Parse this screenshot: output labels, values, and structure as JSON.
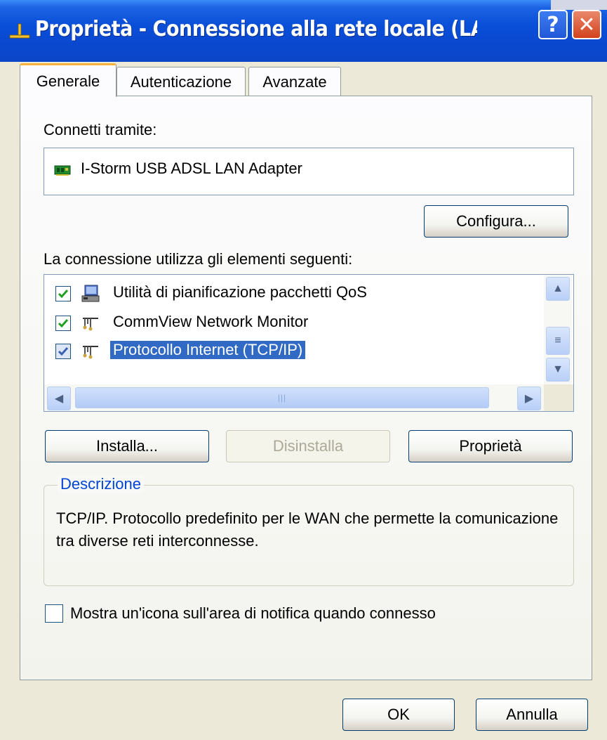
{
  "window": {
    "title": "Proprietà - Connessione alla rete locale (LAN...",
    "help_label": "?",
    "close_label": "✕"
  },
  "tabs": [
    {
      "label": "Generale",
      "active": true
    },
    {
      "label": "Autenticazione",
      "active": false
    },
    {
      "label": "Avanzate",
      "active": false
    }
  ],
  "general": {
    "connect_via_label": "Connetti tramite:",
    "adapter_name": "I-Storm USB ADSL LAN Adapter",
    "configure_button": "Configura...",
    "items_label": "La connessione utilizza gli elementi seguenti:",
    "items": [
      {
        "label": "Utilità di pianificazione pacchetti QoS",
        "checked": true,
        "icon": "qos-scheduler-icon"
      },
      {
        "label": "CommView Network Monitor",
        "checked": true,
        "icon": "network-protocol-icon"
      },
      {
        "label": "Protocollo Internet (TCP/IP)",
        "checked": true,
        "icon": "network-protocol-icon",
        "selected": true
      }
    ],
    "install_button": "Installa...",
    "uninstall_button": "Disinstalla",
    "properties_button": "Proprietà",
    "description_title": "Descrizione",
    "description_text": "TCP/IP. Protocollo predefinito per le WAN che permette la comunicazione tra diverse reti interconnesse.",
    "notify_label": "Mostra un'icona sull'area di notifica quando connesso",
    "notify_checked": false
  },
  "footer": {
    "ok_button": "OK",
    "cancel_button": "Annulla"
  },
  "colors": {
    "titlebar": "#0a4fd8",
    "selection": "#316ac5",
    "groupbox_title": "#0046d5",
    "dialog_bg": "#ece9d8"
  }
}
